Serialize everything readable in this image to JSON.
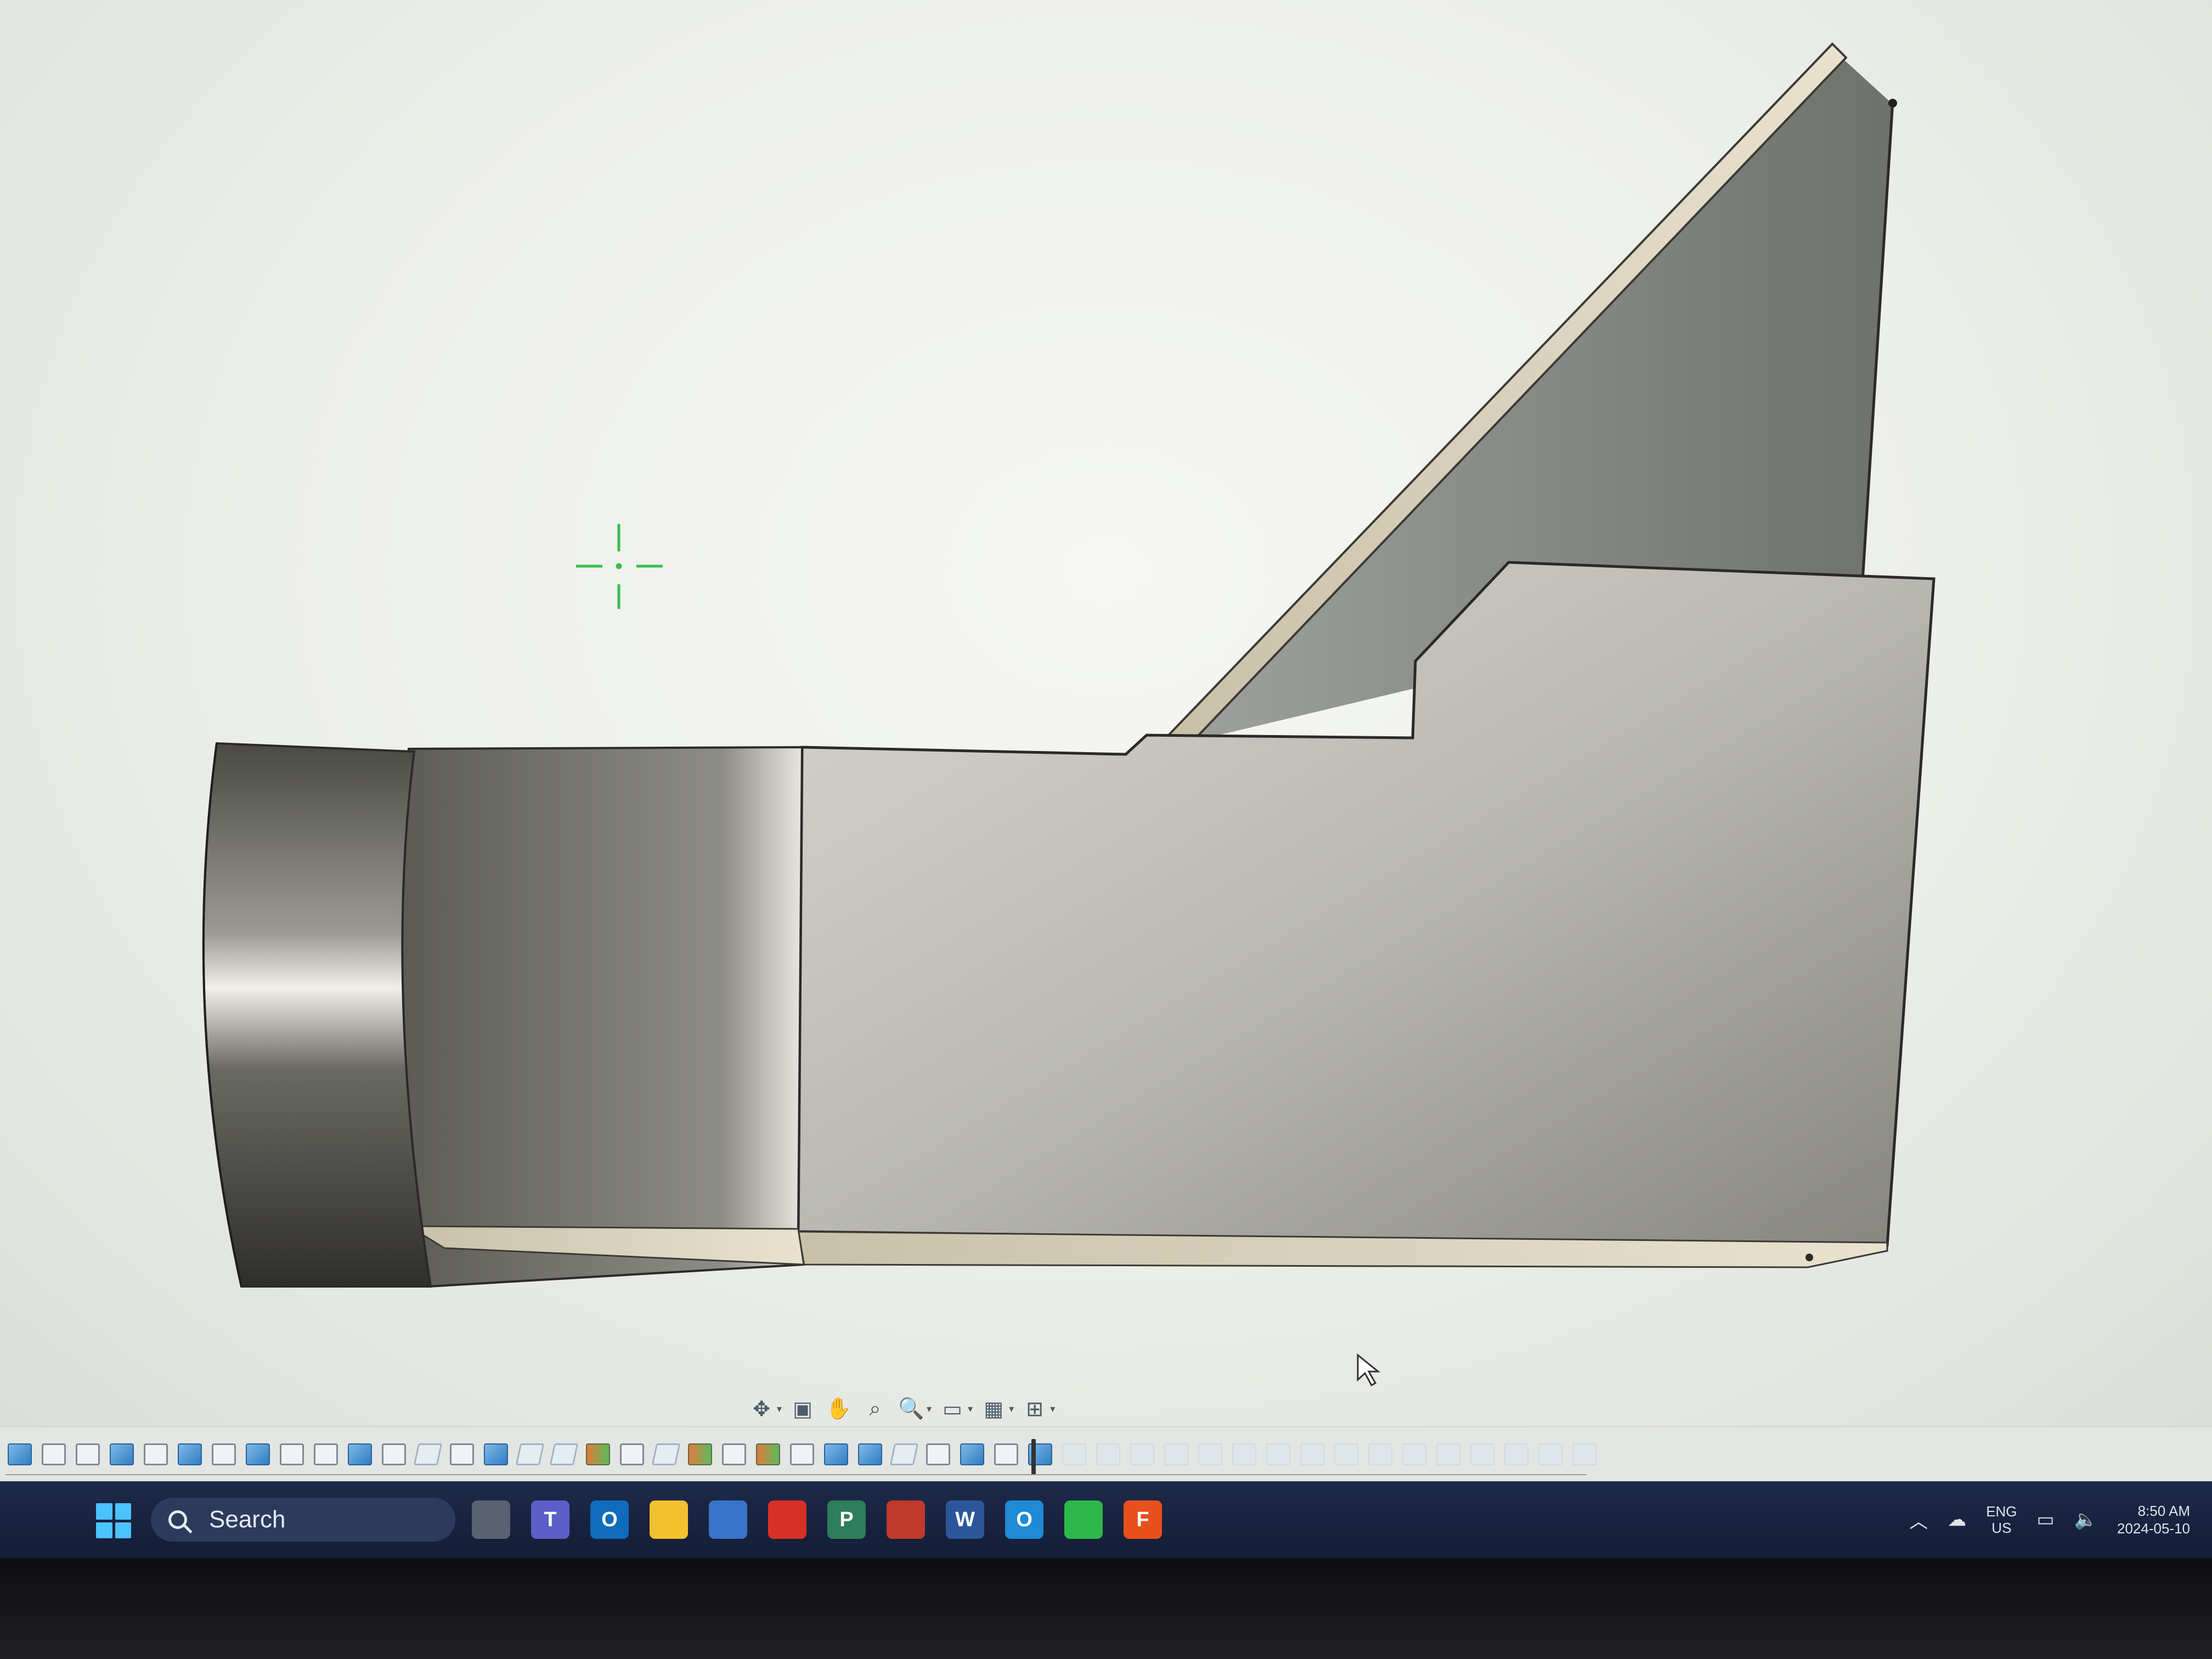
{
  "app": {
    "viewport_label": "3D model viewport",
    "bg_color": "#eceee9",
    "model_color": "#8c8b85"
  },
  "nav_toolbar": {
    "tools": [
      "orbit-icon",
      "look-at-icon",
      "pan-icon",
      "zoom-icon",
      "zoom-window-icon",
      "display-settings-icon",
      "grid-icon",
      "viewports-icon"
    ]
  },
  "timeline": {
    "features": [
      "extrude",
      "sketch",
      "sketch",
      "extrude",
      "sketch",
      "extrude",
      "sketch",
      "extrude",
      "sketch",
      "sketch",
      "extrude",
      "sketch",
      "plane",
      "sketch",
      "extrude",
      "plane",
      "plane",
      "loft",
      "sketch",
      "plane",
      "loft",
      "sketch",
      "loft",
      "sketch",
      "extrude",
      "extrude",
      "plane",
      "sketch",
      "extrude",
      "sketch",
      "extrude"
    ],
    "future_count": 16
  },
  "taskbar": {
    "search_label": "Search",
    "apps": [
      {
        "name": "task-view-icon",
        "label": "",
        "color": "#5a6170"
      },
      {
        "name": "teams-icon",
        "label": "T",
        "color": "#5b5fc7"
      },
      {
        "name": "outlook-icon",
        "label": "O",
        "color": "#0f6cbd"
      },
      {
        "name": "file-explorer-icon",
        "label": "",
        "color": "#f2c12e"
      },
      {
        "name": "store-icon",
        "label": "",
        "color": "#3a74c9"
      },
      {
        "name": "chrome-icon",
        "label": "",
        "color": "#d93025"
      },
      {
        "name": "project-icon",
        "label": "P",
        "color": "#2e7d5b"
      },
      {
        "name": "media-player-icon",
        "label": "",
        "color": "#c0392b"
      },
      {
        "name": "word-icon",
        "label": "W",
        "color": "#2b579a"
      },
      {
        "name": "outlook-new-icon",
        "label": "O",
        "color": "#1f8ad6"
      },
      {
        "name": "green-app-icon",
        "label": "",
        "color": "#2fb84a"
      },
      {
        "name": "fusion-icon",
        "label": "F",
        "color": "#e8501c"
      }
    ],
    "tray": {
      "lang_top": "ENG",
      "lang_bottom": "US",
      "time": "8:50 AM",
      "date": "2024-05-10"
    }
  }
}
